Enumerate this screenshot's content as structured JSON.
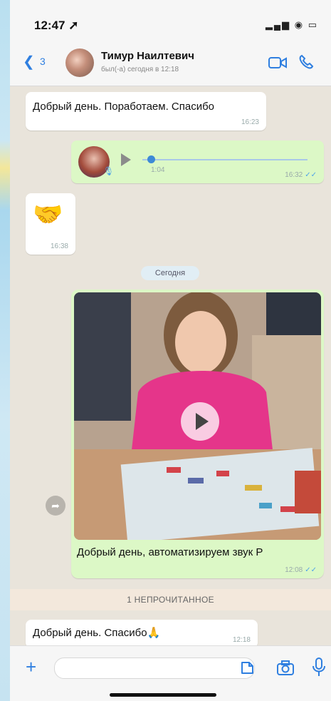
{
  "status_bar": {
    "time": "12:47 ➚",
    "icons": "▂▄▆ ◉ ▭"
  },
  "header": {
    "back_count": "3",
    "contact_name": "Тимур Наилтевич",
    "contact_status": "был(-а) сегодня в 12:18"
  },
  "messages": [
    {
      "type": "text",
      "direction": "in",
      "text": "Добрый день. Поработаем. Спасибо",
      "time": "16:23"
    },
    {
      "type": "voice",
      "direction": "out",
      "duration": "1:04",
      "time": "16:32",
      "progress": 0.03
    },
    {
      "type": "emoji",
      "direction": "in",
      "emoji": "🤝",
      "time": "16:38"
    },
    {
      "type": "video",
      "direction": "out",
      "caption": "Добрый день, автоматизируем звук Р",
      "time": "12:08"
    },
    {
      "type": "text",
      "direction": "in",
      "text": "Добрый день. Спасибо🙏",
      "time": "12:18"
    }
  ],
  "date_separator": "Сегодня",
  "unread_separator": "1 НЕПРОЧИТАННОЕ",
  "icons": {
    "back": "chevron-left-icon",
    "video_call": "video-camera-icon",
    "voice_call": "phone-icon",
    "attach": "plus-icon",
    "sticker": "sticker-icon",
    "camera": "camera-icon",
    "mic": "microphone-icon"
  },
  "colors": {
    "accent": "#2f7fe0",
    "outgoing": "#dcf8c6",
    "incoming": "#ffffff",
    "chat_bg": "#e9e4db"
  }
}
